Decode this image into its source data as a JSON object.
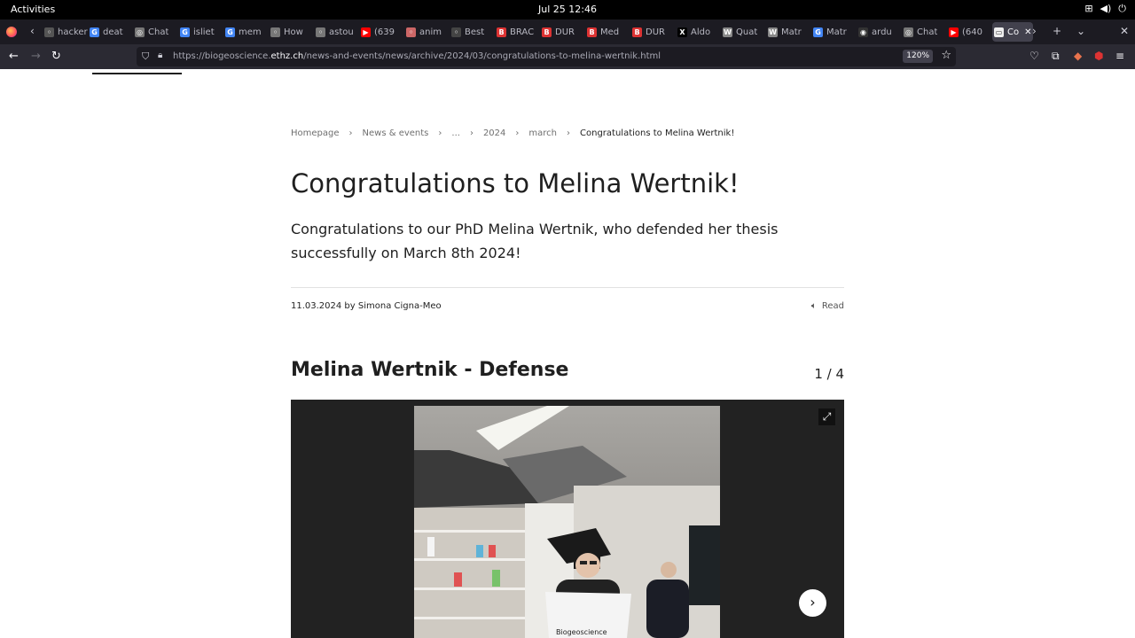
{
  "system": {
    "activities": "Activities",
    "clock": "Jul 25  12:46"
  },
  "tabs": [
    {
      "title": "hackers",
      "icon": "generic",
      "color": "#555"
    },
    {
      "title": "deat",
      "icon": "google",
      "color": "#4285f4"
    },
    {
      "title": "Chat",
      "icon": "chatgpt",
      "color": "#777"
    },
    {
      "title": "isliet",
      "icon": "google",
      "color": "#4285f4"
    },
    {
      "title": "mem",
      "icon": "google",
      "color": "#4285f4"
    },
    {
      "title": "How",
      "icon": "generic",
      "color": "#777"
    },
    {
      "title": "astou",
      "icon": "generic",
      "color": "#777"
    },
    {
      "title": "(639",
      "icon": "youtube",
      "color": "#ff0000"
    },
    {
      "title": "anim",
      "icon": "generic",
      "color": "#c66"
    },
    {
      "title": "Best",
      "icon": "generic",
      "color": "#444"
    },
    {
      "title": "BRAC",
      "icon": "b",
      "color": "#d33"
    },
    {
      "title": "DUR",
      "icon": "b",
      "color": "#d33"
    },
    {
      "title": "Med",
      "icon": "b",
      "color": "#d33"
    },
    {
      "title": "DUR",
      "icon": "b",
      "color": "#d33"
    },
    {
      "title": "Aldo",
      "icon": "x",
      "color": "#000"
    },
    {
      "title": "Quat",
      "icon": "w",
      "color": "#888"
    },
    {
      "title": "Matr",
      "icon": "w",
      "color": "#888"
    },
    {
      "title": "Matr",
      "icon": "google",
      "color": "#4285f4"
    },
    {
      "title": "ardu",
      "icon": "github",
      "color": "#333"
    },
    {
      "title": "Chat",
      "icon": "chatgpt",
      "color": "#777"
    },
    {
      "title": "(640",
      "icon": "youtube",
      "color": "#ff0000"
    }
  ],
  "active_tab": {
    "title": "Co"
  },
  "address": {
    "url_prefix": "https://biogeoscience.",
    "url_domain": "ethz.ch",
    "url_path": "/news-and-events/news/archive/2024/03/congratulations-to-melina-wertnik.html",
    "zoom": "120%"
  },
  "breadcrumb": [
    "Homepage",
    "News & events",
    "...",
    "2024",
    "march"
  ],
  "breadcrumb_current": "Congratulations to Melina Wertnik!",
  "article": {
    "title": "Congratulations to Melina Wertnik!",
    "lead": "Congratulations to our PhD Melina Wertnik, who defended her thesis successfully on March 8th 2024!",
    "meta": "11.03.2024 by Simona Cigna-Meo",
    "read_label": "Read"
  },
  "gallery": {
    "title": "Melina Wertnik - Defense",
    "counter": "1 / 4",
    "shirt_text": "Biogeoscience"
  },
  "colors": {
    "topbar": "#000000",
    "tabstrip": "#1c1b22",
    "navbar": "#2b2a33",
    "gallery_bg": "#222222"
  }
}
